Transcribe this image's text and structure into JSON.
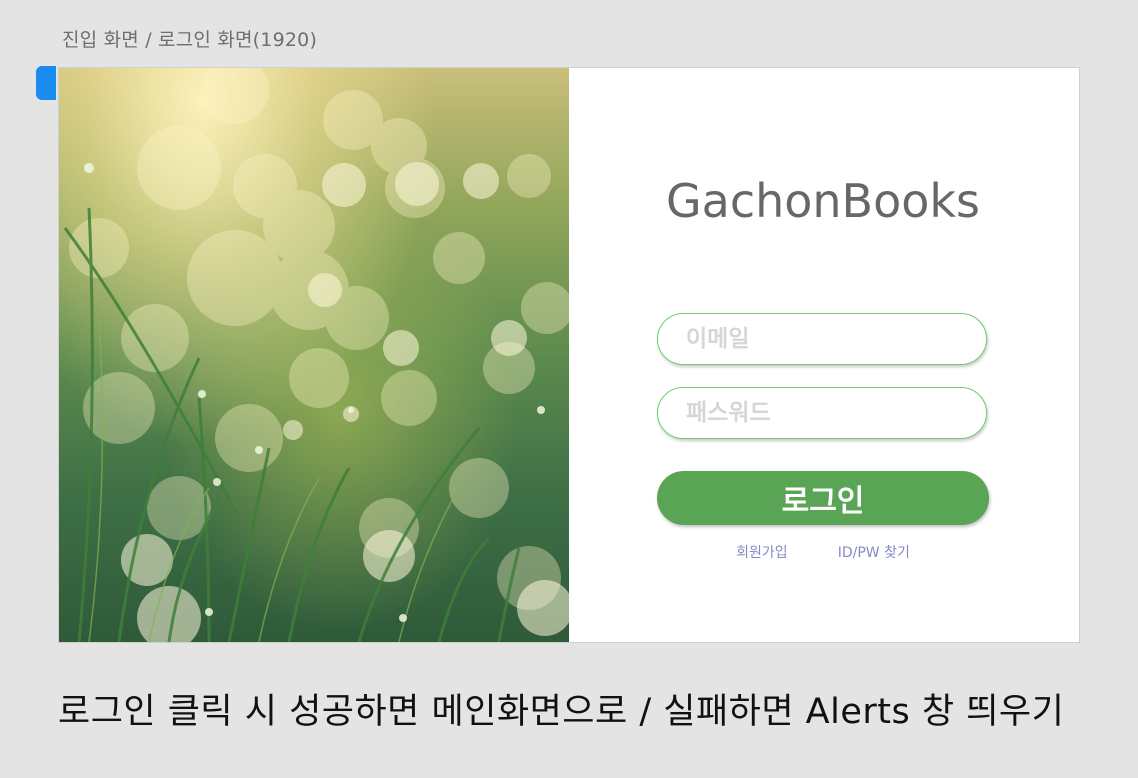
{
  "canvas": {
    "frame_label": "진입 화면 / 로그인 화면(1920)",
    "annotation": "로그인 클릭 시 성공하면 메인화면으로 / 실패하면 Alerts 창 띄우기"
  },
  "login": {
    "brand_title": "GachonBooks",
    "email_placeholder": "이메일",
    "password_placeholder": "패스워드",
    "submit_label": "로그인",
    "signup_link": "회원가입",
    "find_account_link": "ID/PW 찾기"
  },
  "colors": {
    "accent_green": "#5aa455",
    "field_border": "#6dd26d",
    "link": "#8888c8",
    "selection": "#1a8cf0"
  }
}
